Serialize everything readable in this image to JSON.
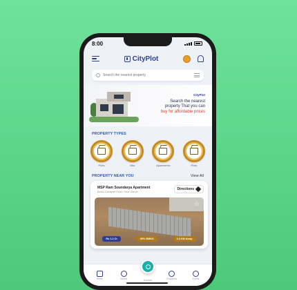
{
  "status": {
    "time": "8:00"
  },
  "header": {
    "brand": "CityPlot"
  },
  "search": {
    "placeholder": "Search the nearest property"
  },
  "banner": {
    "mini_brand": "CityPlot",
    "line1": "Search the nearest",
    "line2": "property That you can",
    "highlight": "buy for affordable prices"
  },
  "property_types": {
    "title": "PROPERTY TYPES",
    "items": [
      {
        "label": "Plots",
        "icon": "plot-icon"
      },
      {
        "label": "Villa",
        "icon": "villa-icon"
      },
      {
        "label": "Apartments",
        "icon": "apartment-icon"
      },
      {
        "label": "Plots",
        "icon": "plot-icon"
      }
    ]
  },
  "nearby": {
    "title": "PROPERTY NEAR YOU",
    "view_all": "View All"
  },
  "card": {
    "title": "MSP Ram Soundarya Apartment",
    "subtitle": "Besta Ganapati Road, Near Sandh",
    "directions": "Directions",
    "pills": [
      "Rs 1.2 Cr",
      "30% BMKD",
      "2.3 KM Away"
    ]
  },
  "bottom_nav": [
    "Home",
    "Saved",
    "Explore",
    "Enquiries",
    "Profile"
  ],
  "colors": {
    "brand": "#2b3e8f",
    "accent": "#c48a1d",
    "background": "#4cc97a"
  }
}
